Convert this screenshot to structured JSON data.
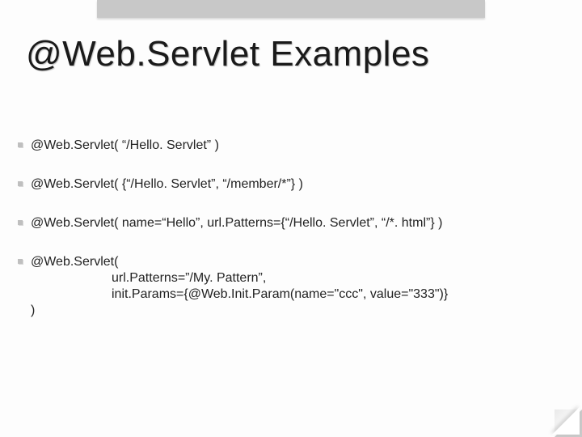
{
  "title": "@Web.Servlet Examples",
  "examples": {
    "e1": "@Web.Servlet( “/Hello. Servlet” )",
    "e2": "@Web.Servlet( {“/Hello. Servlet”, “/member/*”} )",
    "e3": "@Web.Servlet( name=“Hello”, url.Patterns={“/Hello. Servlet”, “/*. html”} )",
    "e4_line1": "@Web.Servlet(",
    "e4_line2": "url.Patterns=”/My. Pattern”,",
    "e4_line3": "init.Params={@Web.Init.Param(name=\"ccc\", value=\"333\")}",
    "e4_line4": ")"
  }
}
